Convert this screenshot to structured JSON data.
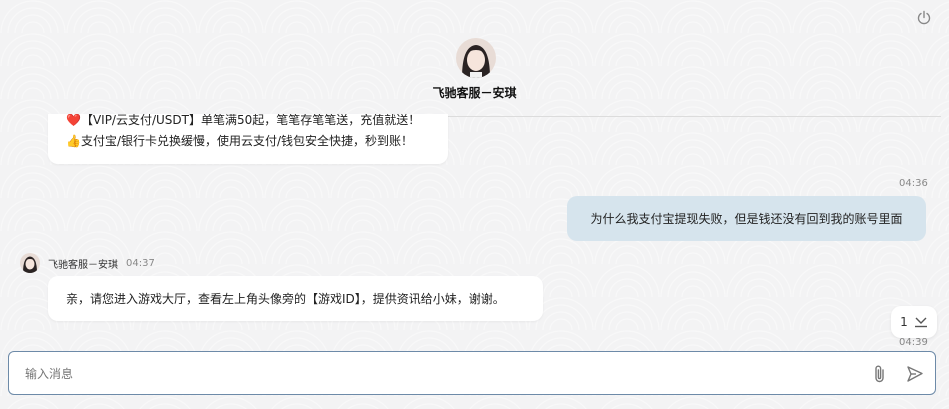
{
  "header": {
    "agent_name": "飞驰客服－安琪"
  },
  "messages": {
    "promo_line1": "❤️【VIP/云支付/USDT】单笔满50起，笔笔存笔笔送，充值就送！",
    "promo_line2": "👍支付宝/银行卡兑换缓慢，使用云支付/钱包安全快捷，秒到账！",
    "user_time": "04:36",
    "user_text": "为什么我支付宝提现失败，但是钱还没有回到我的账号里面",
    "reply_sender": "飞驰客服－安琪",
    "reply_time": "04:37",
    "reply_text": "亲，请您进入游戏大厅，查看左上角头像旁的【游戏ID】，提供资讯给小妹，谢谢。",
    "next_time": "04:39"
  },
  "unread": {
    "count": "1"
  },
  "composer": {
    "placeholder": "输入消息",
    "value": ""
  },
  "icons": {
    "power": "power-icon",
    "attach": "paperclip-icon",
    "send": "send-icon",
    "scroll_down": "scroll-down-icon"
  },
  "colors": {
    "user_bubble": "#d6e4ed",
    "input_border": "#6d8aa8"
  }
}
